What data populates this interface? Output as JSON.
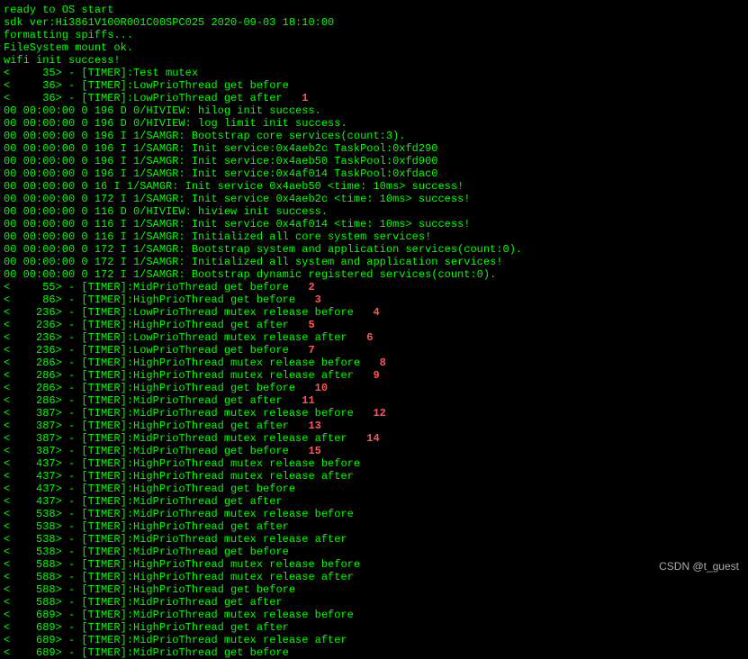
{
  "watermark": "CSDN @t_guest",
  "lines": [
    "ready to OS start",
    "sdk ver:Hi3861V100R001C00SPC025 2020-09-03 18:10:00",
    "formatting spiffs...",
    "FileSystem mount ok.",
    "wifi init success!",
    "<     35> - [TIMER]:Test mutex",
    "",
    "<     36> - [TIMER]:LowPrioThread get before",
    "<     36> - [TIMER]:LowPrioThread get after",
    "00 00:00:00 0 196 D 0/HIVIEW: hilog init success.",
    "00 00:00:00 0 196 D 0/HIVIEW: log limit init success.",
    "00 00:00:00 0 196 I 1/SAMGR: Bootstrap core services(count:3).",
    "00 00:00:00 0 196 I 1/SAMGR: Init service:0x4aeb2c TaskPool:0xfd290",
    "00 00:00:00 0 196 I 1/SAMGR: Init service:0x4aeb50 TaskPool:0xfd900",
    "00 00:00:00 0 196 I 1/SAMGR: Init service:0x4af014 TaskPool:0xfdac0",
    "00 00:00:00 0 16 I 1/SAMGR: Init service 0x4aeb50 <time: 10ms> success!",
    "00 00:00:00 0 172 I 1/SAMGR: Init service 0x4aeb2c <time: 10ms> success!",
    "00 00:00:00 0 116 D 0/HIVIEW: hiview init success.",
    "00 00:00:00 0 116 I 1/SAMGR: Init service 0x4af014 <time: 10ms> success!",
    "00 00:00:00 0 116 I 1/SAMGR: Initialized all core system services!",
    "00 00:00:00 0 172 I 1/SAMGR: Bootstrap system and application services(count:0).",
    "00 00:00:00 0 172 I 1/SAMGR: Initialized all system and application services!",
    "00 00:00:00 0 172 I 1/SAMGR: Bootstrap dynamic registered services(count:0).",
    "<     55> - [TIMER]:MidPrioThread get before",
    "<     86> - [TIMER]:HighPrioThread get before",
    "<    236> - [TIMER]:LowPrioThread mutex release before",
    "<    236> - [TIMER]:HighPrioThread get after",
    "<    236> - [TIMER]:LowPrioThread mutex release after",
    "<    236> - [TIMER]:LowPrioThread get before",
    "<    286> - [TIMER]:HighPrioThread mutex release before",
    "<    286> - [TIMER]:HighPrioThread mutex release after",
    "<    286> - [TIMER]:HighPrioThread get before",
    "<    286> - [TIMER]:MidPrioThread get after",
    "<    387> - [TIMER]:MidPrioThread mutex release before",
    "<    387> - [TIMER]:HighPrioThread get after",
    "<    387> - [TIMER]:MidPrioThread mutex release after",
    "<    387> - [TIMER]:MidPrioThread get before",
    "<    437> - [TIMER]:HighPrioThread mutex release before",
    "<    437> - [TIMER]:HighPrioThread mutex release after",
    "<    437> - [TIMER]:HighPrioThread get before",
    "<    437> - [TIMER]:MidPrioThread get after",
    "<    538> - [TIMER]:MidPrioThread mutex release before",
    "<    538> - [TIMER]:HighPrioThread get after",
    "<    538> - [TIMER]:MidPrioThread mutex release after",
    "<    538> - [TIMER]:MidPrioThread get before",
    "<    588> - [TIMER]:HighPrioThread mutex release before",
    "<    588> - [TIMER]:HighPrioThread mutex release after",
    "<    588> - [TIMER]:HighPrioThread get before",
    "<    588> - [TIMER]:MidPrioThread get after",
    "<    689> - [TIMER]:MidPrioThread mutex release before",
    "<    689> - [TIMER]:HighPrioThread get after",
    "<    689> - [TIMER]:MidPrioThread mutex release after",
    "<    689> - [TIMER]:MidPrioThread get before"
  ],
  "annotations": {
    "8": "1",
    "23": "2",
    "24": "3",
    "25": "4",
    "26": "5",
    "27": "6",
    "28": "7",
    "29": "8",
    "30": "9",
    "31": "10",
    "32": "11",
    "33": "12",
    "34": "13",
    "35": "14",
    "36": "15"
  }
}
